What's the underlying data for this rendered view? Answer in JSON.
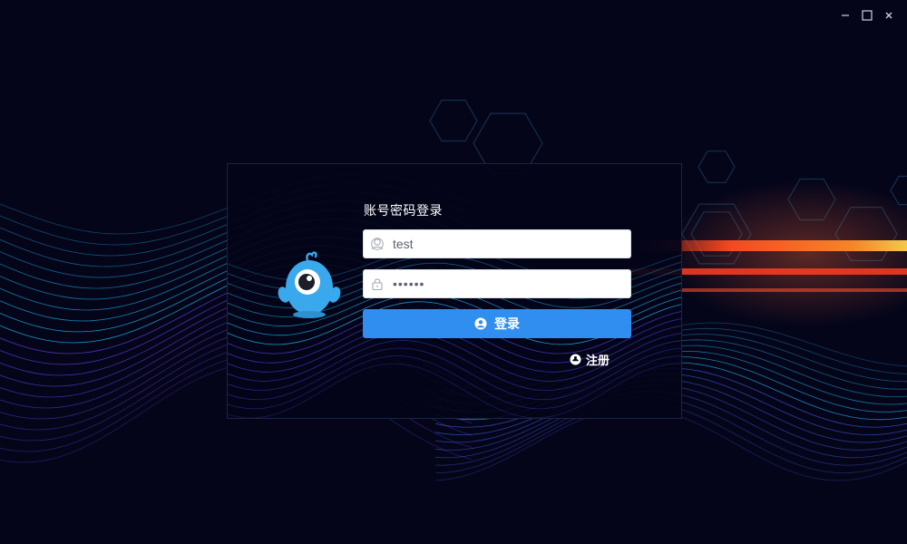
{
  "window": {
    "controls": [
      "minimize",
      "maximize",
      "close"
    ]
  },
  "login": {
    "title": "账号密码登录",
    "username": {
      "value": "test",
      "icon": "user-icon"
    },
    "password": {
      "value": "••••••",
      "icon": "lock-icon"
    },
    "submit_label": "登录",
    "register_label": "注册"
  },
  "colors": {
    "background": "#05051a",
    "panel": "#040418",
    "primary": "#2f8ef0",
    "mascot": "#3aa8ec",
    "wave_cyan": "#1fb6e8",
    "wave_purple": "#5d3fd3",
    "streak_orange": "#ff5a2a"
  }
}
